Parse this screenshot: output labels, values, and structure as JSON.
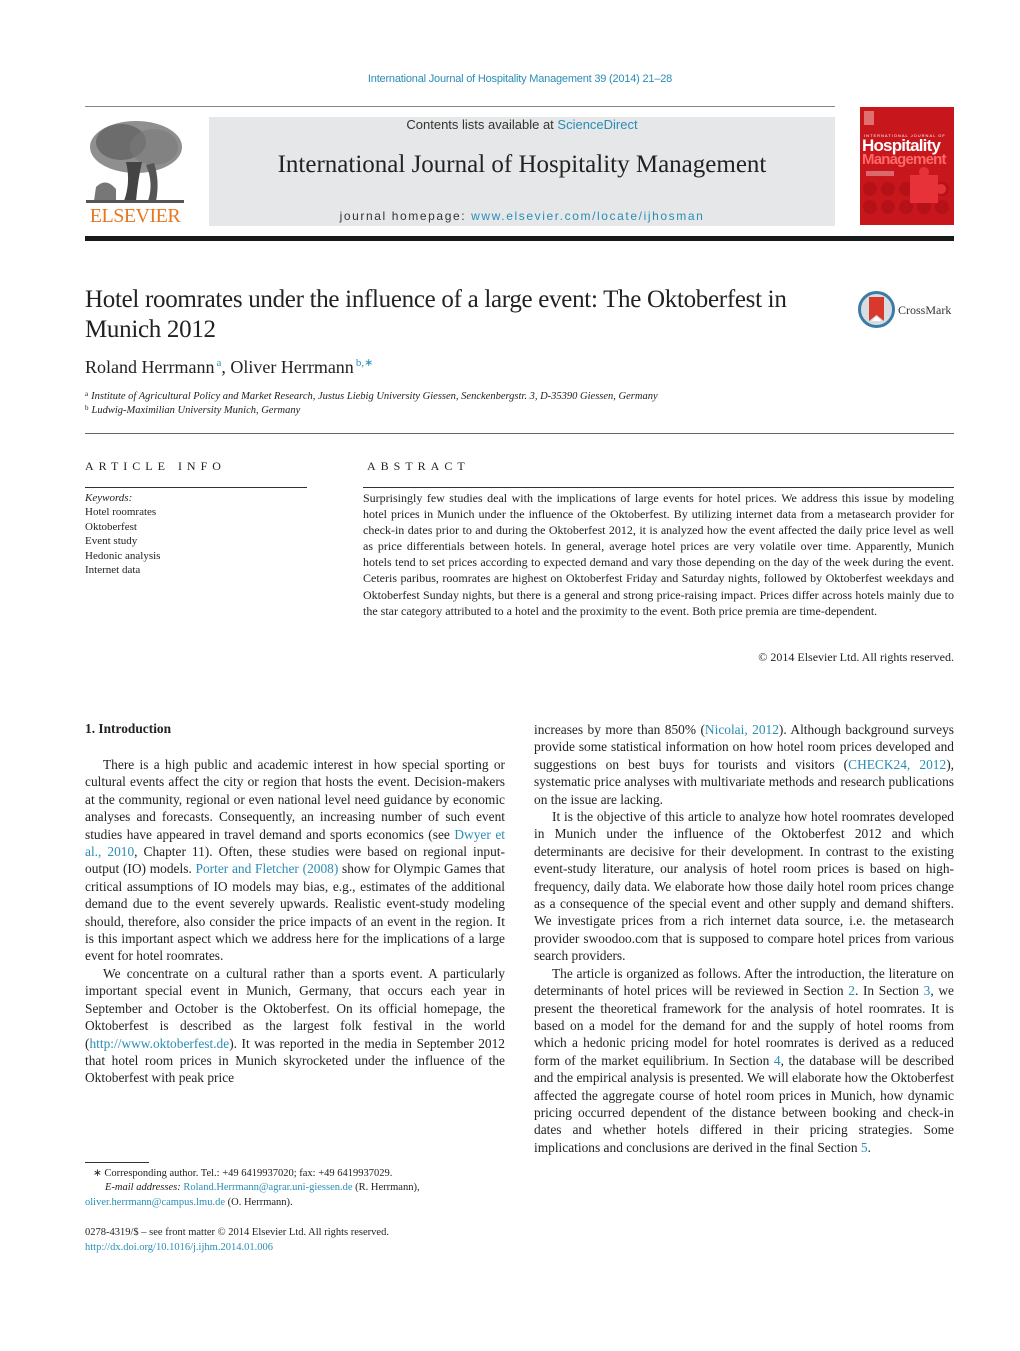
{
  "header": {
    "journal_citation": "International Journal of Hospitality Management 39 (2014) 21–28",
    "contents_prefix": "Contents lists available at ",
    "contents_link": "ScienceDirect",
    "journal_name": "International Journal of Hospitality Management",
    "homepage_prefix": "journal homepage: ",
    "homepage_link": "www.elsevier.com/locate/ijhosman",
    "publisher_logo_text": "ELSEVIER",
    "cover": {
      "top_line": "INTERNATIONAL JOURNAL OF",
      "title_1": "Hospitality",
      "title_2": "Management"
    }
  },
  "article": {
    "title": "Hotel roomrates under the influence of a large event: The Oktoberfest in Munich 2012",
    "crossmark_label": "CrossMark",
    "authors": [
      {
        "name": "Roland Herrmann",
        "sup": "a"
      },
      {
        "name": "Oliver Herrmann",
        "sup": "b,∗"
      }
    ],
    "affiliations": [
      {
        "mark": "a",
        "text": "Institute of Agricultural Policy and Market Research, Justus Liebig University Giessen, Senckenbergstr. 3, D-35390 Giessen, Germany"
      },
      {
        "mark": "b",
        "text": "Ludwig-Maximilian University Munich, Germany"
      }
    ]
  },
  "article_info": {
    "heading": "ARTICLE INFO",
    "keywords_label": "Keywords:",
    "keywords": [
      "Hotel roomrates",
      "Oktoberfest",
      "Event study",
      "Hedonic analysis",
      "Internet data"
    ]
  },
  "abstract": {
    "heading": "ABSTRACT",
    "text": "Surprisingly few studies deal with the implications of large events for hotel prices. We address this issue by modeling hotel prices in Munich under the influence of the Oktoberfest. By utilizing internet data from a metasearch provider for check-in dates prior to and during the Oktoberfest 2012, it is analyzed how the event affected the daily price level as well as price differentials between hotels. In general, average hotel prices are very volatile over time. Apparently, Munich hotels tend to set prices according to expected demand and vary those depending on the day of the week during the event. Ceteris paribus, roomrates are highest on Oktoberfest Friday and Saturday nights, followed by Oktoberfest weekdays and Oktoberfest Sunday nights, but there is a general and strong price-raising impact. Prices differ across hotels mainly due to the star category attributed to a hotel and the proximity to the event. Both price premia are time-dependent.",
    "copyright": "© 2014 Elsevier Ltd. All rights reserved."
  },
  "body": {
    "section_heading": "1.  Introduction",
    "left": {
      "p1_a": "There is a high public and academic interest in how special sporting or cultural events affect the city or region that hosts the event. Decision-makers at the community, regional or even national level need guidance by economic analyses and forecasts. Consequently, an increasing number of such event studies have appeared in travel demand and sports economics (see ",
      "p1_link1": "Dwyer et al., 2010",
      "p1_b": ", Chapter 11). Often, these studies were based on regional input-output (IO) models. ",
      "p1_link2": "Porter and Fletcher (2008)",
      "p1_c": " show for Olympic Games that critical assumptions of IO models may bias, e.g., estimates of the additional demand due to the event severely upwards. Realistic event-study modeling should, therefore, also consider the price impacts of an event in the region. It is this important aspect which we address here for the implications of a large event for hotel roomrates.",
      "p2_a": "We concentrate on a cultural rather than a sports event. A particularly important special event in Munich, Germany, that occurs each year in September and October is the Oktoberfest. On its official homepage, the Oktoberfest is described as the largest folk festival in the world (",
      "p2_link": "http://www.oktoberfest.de",
      "p2_b": "). It was reported in the media in September 2012 that hotel room prices in Munich skyrocketed under the influence of the Oktoberfest with peak price"
    },
    "right": {
      "p1_a": "increases by more than 850% (",
      "p1_link1": "Nicolai, 2012",
      "p1_b": "). Although background surveys provide some statistical information on how hotel room prices developed and suggestions on best buys for tourists and visitors (",
      "p1_link2": "CHECK24, 2012",
      "p1_c": "), systematic price analyses with multivariate methods and research publications on the issue are lacking.",
      "p2": "It is the objective of this article to analyze how hotel roomrates developed in Munich under the influence of the Oktoberfest 2012 and which determinants are decisive for their development. In contrast to the existing event-study literature, our analysis of hotel room prices is based on high-frequency, daily data. We elaborate how those daily hotel room prices change as a consequence of the special event and other supply and demand shifters. We investigate prices from a rich internet data source, i.e. the metasearch provider swoodoo.com that is supposed to compare hotel prices from various search providers.",
      "p3_a": "The article is organized as follows. After the introduction, the literature on determinants of hotel prices will be reviewed in Section ",
      "p3_s2": "2",
      "p3_b": ". In Section ",
      "p3_s3": "3",
      "p3_c": ", we present the theoretical framework for the analysis of hotel roomrates. It is based on a model for the demand for and the supply of hotel rooms from which a hedonic pricing model for hotel roomrates is derived as a reduced form of the market equilibrium. In Section ",
      "p3_s4": "4",
      "p3_d": ", the database will be described and the empirical analysis is presented. We will elaborate how the Oktoberfest affected the aggregate course of hotel room prices in Munich, how dynamic pricing occurred dependent of the distance between booking and check-in dates and whether hotels differed in their pricing strategies. Some implications and conclusions are derived in the final Section ",
      "p3_s5": "5",
      "p3_e": "."
    }
  },
  "footnotes": {
    "corresponding": "∗  Corresponding author. Tel.: +49 6419937020; fax: +49 6419937029.",
    "email_label": "E-mail addresses:",
    "email1": "Roland.Herrmann@agrar.uni-giessen.de",
    "email1_who": " (R. Herrmann),",
    "email2": "oliver.herrmann@campus.lmu.de",
    "email2_who": " (O. Herrmann).",
    "front_matter": "0278-4319/$ – see front matter © 2014 Elsevier Ltd. All rights reserved.",
    "doi": "http://dx.doi.org/10.1016/j.ijhm.2014.01.006"
  },
  "colors": {
    "link": "#2a8db5",
    "elsevier_orange": "#e87722",
    "cover_red": "#c8161d",
    "banner_gray": "#e6e7e8"
  }
}
